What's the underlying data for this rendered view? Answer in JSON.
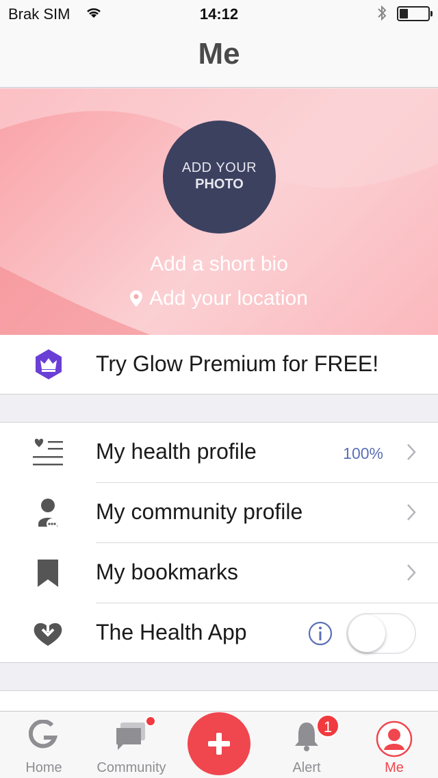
{
  "status_bar": {
    "carrier": "Brak SIM",
    "time": "14:12"
  },
  "nav": {
    "title": "Me"
  },
  "hero": {
    "photo_line1": "ADD YOUR",
    "photo_line2": "PHOTO",
    "bio": "Add a short bio",
    "location": "Add your location"
  },
  "premium": {
    "label": "Try Glow Premium for FREE!",
    "icon": "crown-icon"
  },
  "settings": [
    {
      "label": "My health profile",
      "value": "100%",
      "icon": "health-list-icon"
    },
    {
      "label": "My community profile",
      "icon": "person-icon"
    },
    {
      "label": "My bookmarks",
      "icon": "bookmark-icon"
    },
    {
      "label": "The Health App",
      "icon": "heart-download-icon",
      "toggle": "off"
    }
  ],
  "tabs": [
    {
      "label": "Home",
      "icon": "glow-logo-icon"
    },
    {
      "label": "Community",
      "icon": "chat-bubbles-icon"
    },
    {
      "label": "",
      "icon": "plus-icon"
    },
    {
      "label": "Alert",
      "icon": "bell-icon",
      "badge": "1"
    },
    {
      "label": "Me",
      "icon": "profile-icon",
      "active": true
    }
  ],
  "colors": {
    "accent": "#f0464e",
    "avatar_bg": "#3d4160",
    "value_blue": "#5b6fb5",
    "premium_purple": "#6a3fd6"
  }
}
